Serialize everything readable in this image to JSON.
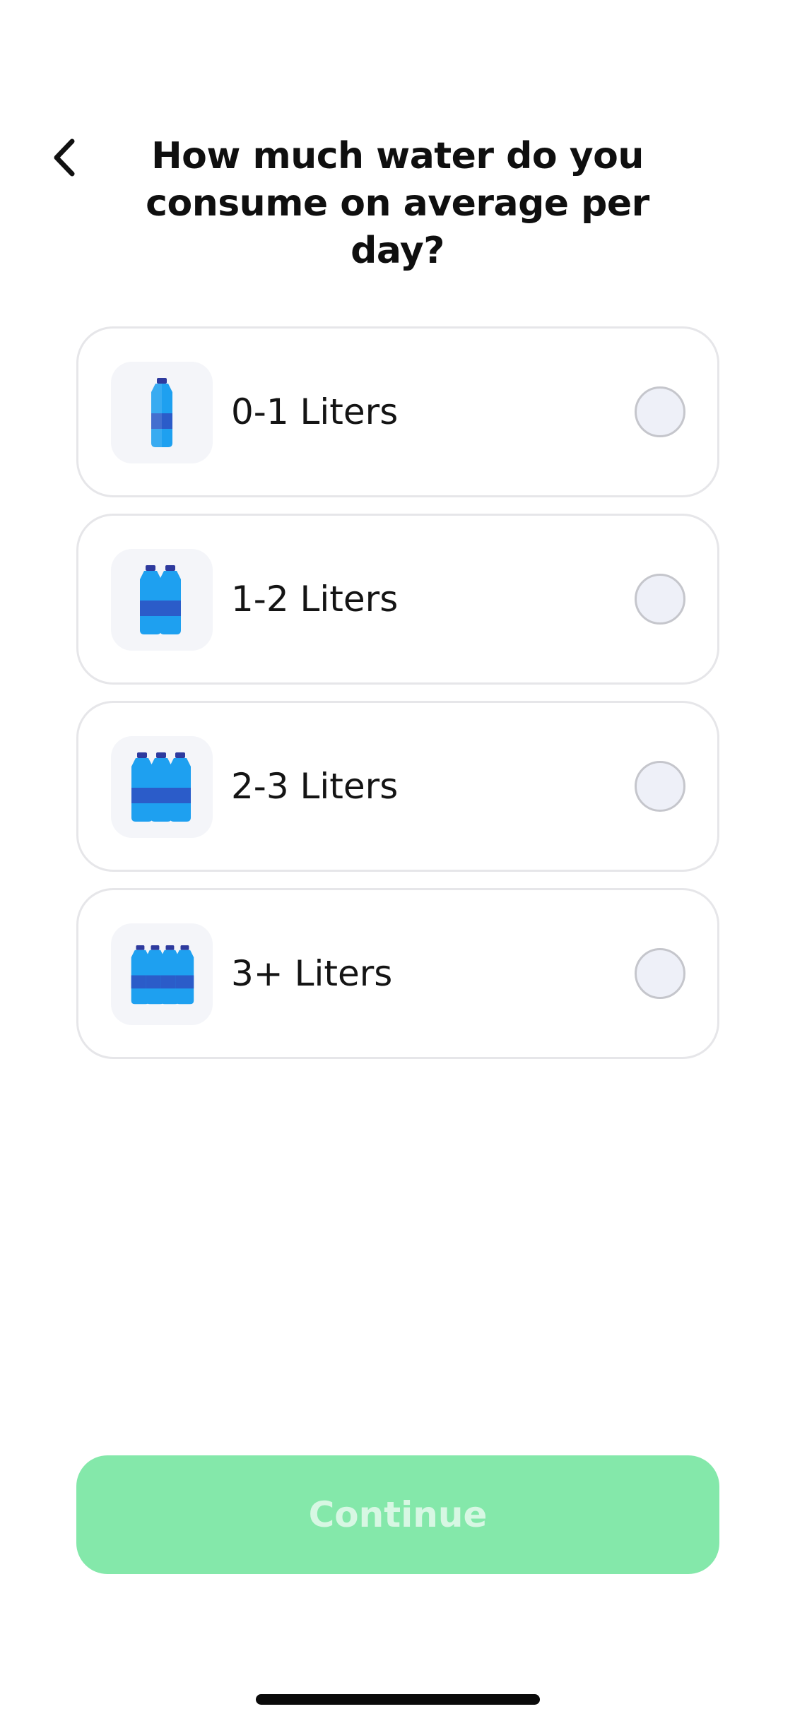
{
  "header": {
    "back_icon": "chevron-left-icon",
    "title": "How much water do you consume on average per day?"
  },
  "options": [
    {
      "label": "0-1 Liters",
      "icon": "one-bottle-icon",
      "selected": false
    },
    {
      "label": "1-2 Liters",
      "icon": "two-bottles-icon",
      "selected": false
    },
    {
      "label": "2-3 Liters",
      "icon": "three-bottles-icon",
      "selected": false
    },
    {
      "label": "3+ Liters",
      "icon": "four-bottles-icon",
      "selected": false
    }
  ],
  "footer": {
    "continue_label": "Continue",
    "continue_enabled": false
  },
  "colors": {
    "accent_disabled": "#84e8aa",
    "bottle_light": "#1ea0f0",
    "bottle_dark": "#2b5cc9",
    "cap": "#2e3a9e",
    "border": "#e6e6e9",
    "radio_fill": "#eef0f8"
  }
}
